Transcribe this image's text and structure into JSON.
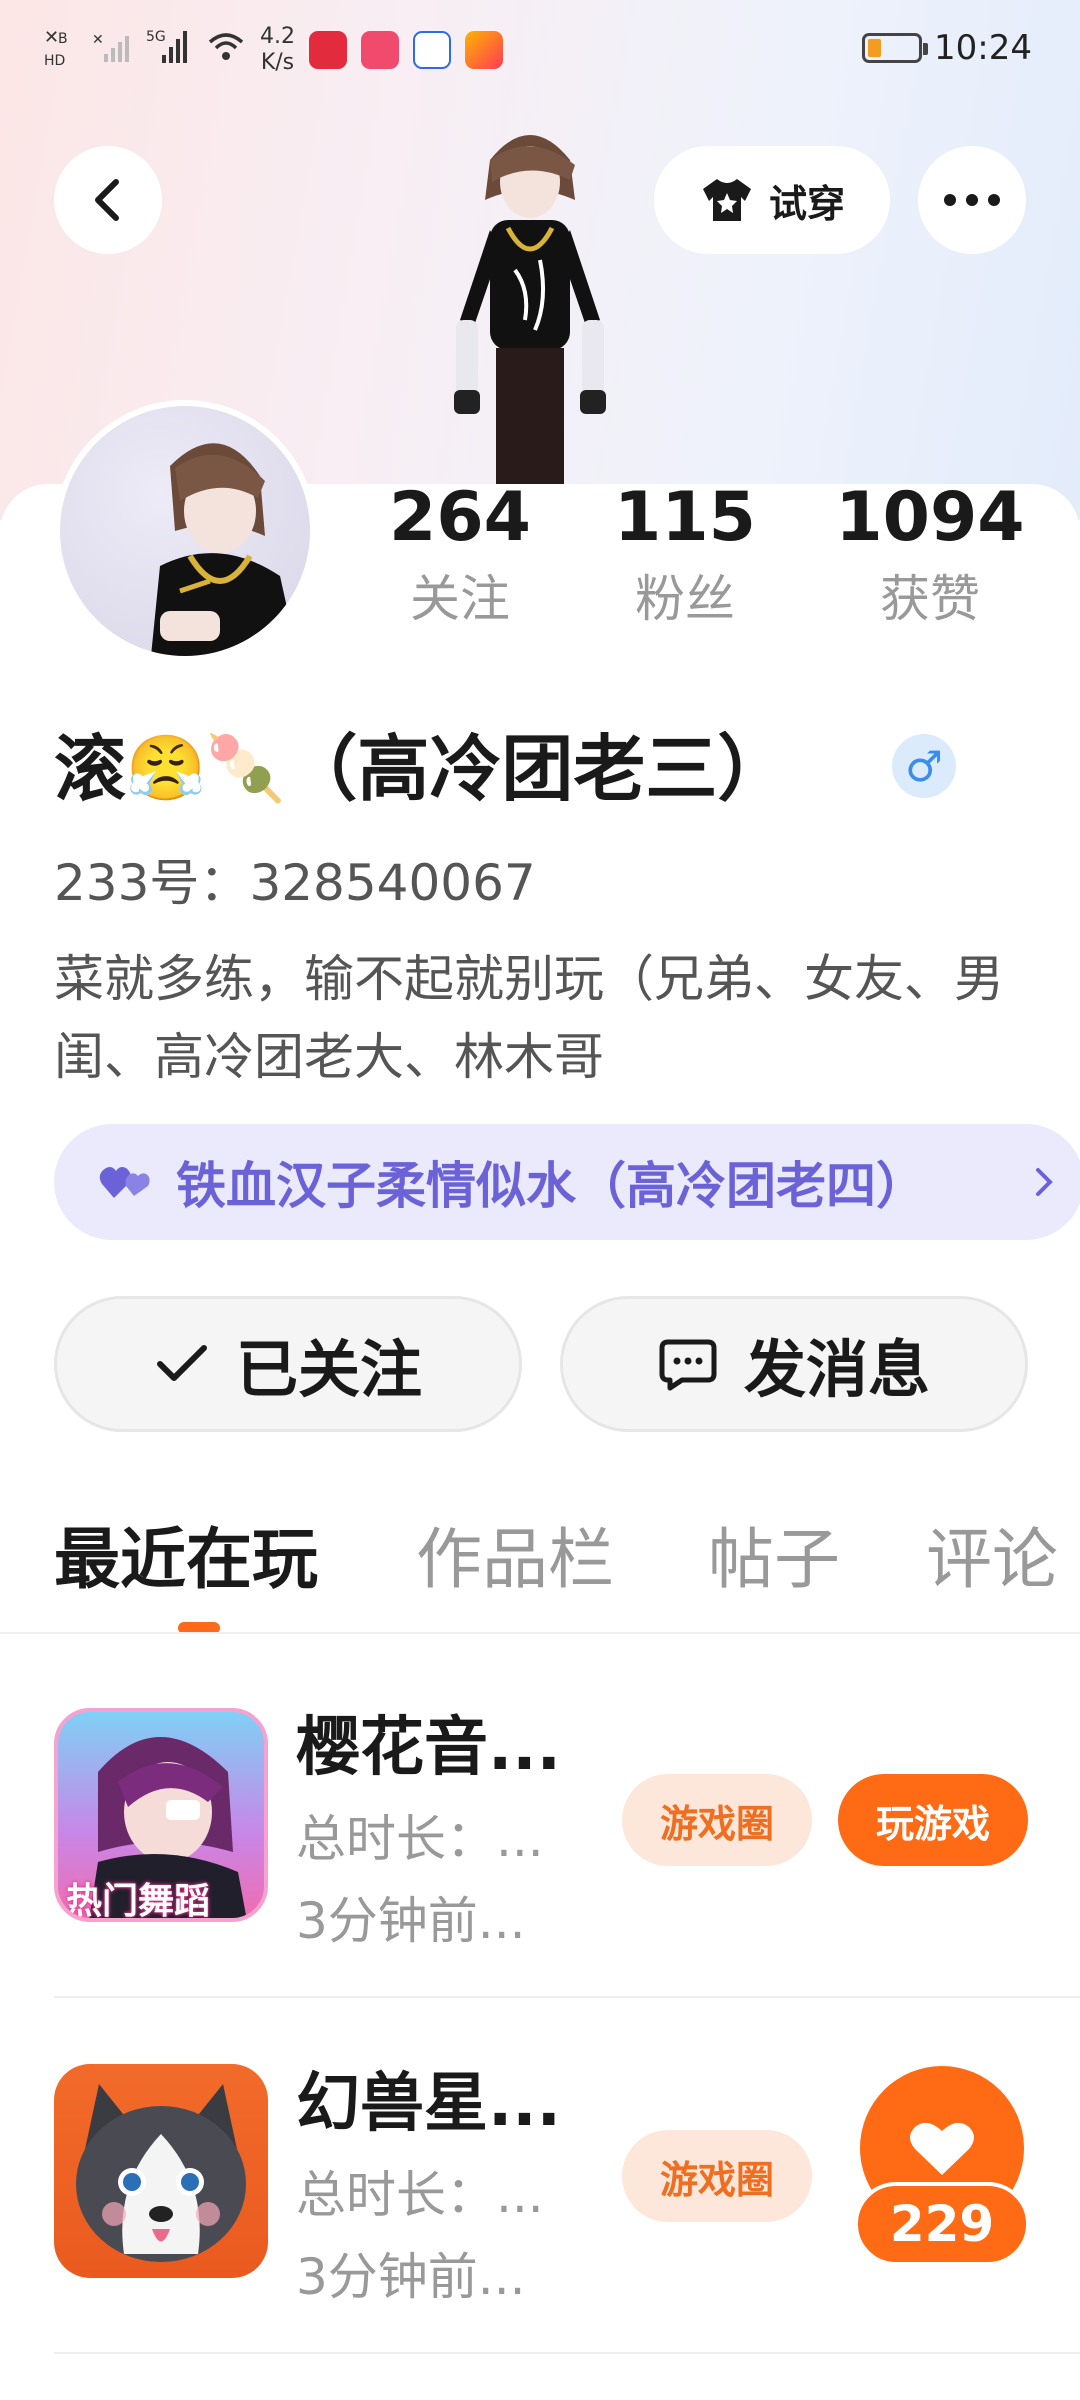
{
  "status_bar": {
    "network_speed_value": "4.2",
    "network_speed_unit": "K/s",
    "network_type": "5G",
    "sim_label": "HD",
    "time": "10:24",
    "battery_level": 0.2
  },
  "header": {
    "tryon_label": "试穿"
  },
  "profile": {
    "stats": [
      {
        "value": "264",
        "label": "关注"
      },
      {
        "value": "115",
        "label": "粉丝"
      },
      {
        "value": "1094",
        "label": "获赞"
      }
    ],
    "nickname_start": "滚",
    "nickname_emoji": "😤🍡",
    "nickname_rest": "（高冷团老三）",
    "gender_symbol": "♂",
    "uid_label": "233号：",
    "uid_value": "328540067",
    "bio": "菜就多练，输不起就别玩（兄弟、女友、男闺、高冷团老大、林木哥",
    "cp_text": "铁血汉子柔情似水（高冷团老四）"
  },
  "actions": {
    "follow_label": "已关注",
    "message_label": "发消息"
  },
  "tabs": [
    {
      "label": "最近在玩",
      "active": true
    },
    {
      "label": "作品栏",
      "active": false
    },
    {
      "label": "帖子",
      "active": false
    },
    {
      "label": "评论",
      "active": false
    }
  ],
  "games": [
    {
      "title": "樱花音...",
      "duration": "总时长：...",
      "last_played": "3分钟前...",
      "circle_label": "游戏圈",
      "play_label": "玩游戏",
      "icon_banner": "热门舞蹈"
    },
    {
      "title": "幻兽星...",
      "duration": "总时长：...",
      "last_played": "3分钟前...",
      "circle_label": "游戏圈"
    }
  ],
  "like_fab": {
    "count": "229"
  },
  "colors": {
    "accent": "#ff6a14",
    "cp_purple": "#6b62d8",
    "gender_blue": "#3a8eea"
  }
}
